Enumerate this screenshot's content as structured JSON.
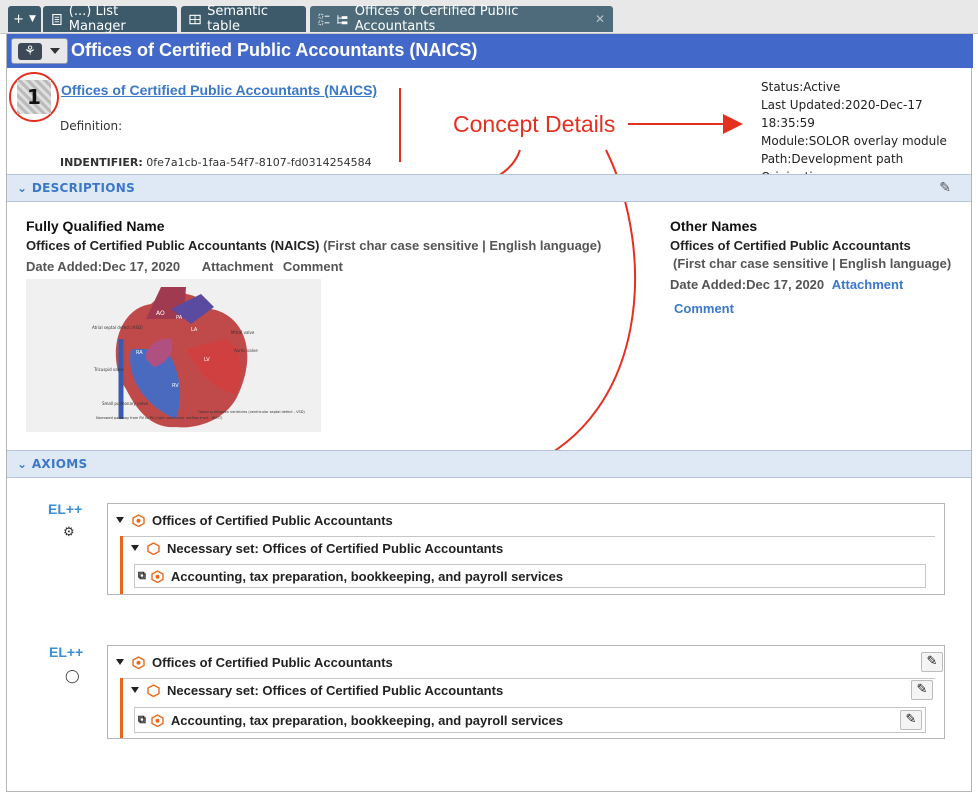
{
  "tabs": {
    "plus": "+",
    "list_manager": "(...) List Manager",
    "semantic_table": "Semantic table",
    "offices": "Offices of Certified Public Accountants"
  },
  "window": {
    "title": "Offices of Certified Public Accountants  (NAICS)"
  },
  "concept": {
    "badge": "1",
    "name": "Offices of Certified Public Accountants  (NAICS)",
    "definition_label": "Definition:",
    "identifier_label": "INDENTIFIER:",
    "identifier_value": "0fe7a1cb-1faa-54f7-8107-fd0314254584"
  },
  "meta": {
    "status_label": "Status:",
    "status_value": "Active",
    "updated_label": "Last Updated:",
    "updated_value": "2020-Dec-17 18:35:59",
    "module_label": "Module:",
    "module_value": "SOLOR overlay module",
    "path_label": "Path:",
    "path_value": "Development path",
    "origination_label": "Origination:"
  },
  "annotation": {
    "title": "Concept Details"
  },
  "descriptions": {
    "section_label": "DESCRIPTIONS",
    "fqn_header": "Fully Qualified Name",
    "fqn_name": "Offices of Certified Public Accountants  (NAICS)",
    "fqn_qualifier": "(First char case sensitive | English language)",
    "fqn_date_label": "Date Added:",
    "fqn_date_value": "Dec 17, 2020",
    "fqn_attachment": "Attachment",
    "fqn_comment": "Comment",
    "other_header": "Other Names",
    "other_name": "Offices of Certified Public Accountants",
    "other_qualifier": "(First char case sensitive | English language)",
    "other_date_label": "Date Added:",
    "other_date_value": "Dec 17, 2020",
    "other_attachment": "Attachment",
    "other_comment": "Comment",
    "heart_labels": {
      "ao": "AO",
      "pa": "PA",
      "la": "LA",
      "ra": "RA",
      "lv": "LV",
      "rv": "RV",
      "asd": "Atrial septal defect (ASD)",
      "mitral": "Mitral valve",
      "aortic": "Aortic valve",
      "tricuspid": "Tricuspid valve",
      "small_pulm": "Small pulmonary valve",
      "narrowed": "Narrowed pathway from RV to PA (right ventricular outflow tract - RVOT)",
      "vsd": "Opening between ventricles (ventricular septal defect - VSD)"
    }
  },
  "axioms": {
    "section_label": "AXIOMS",
    "el_label_1": "EL++",
    "el_label_2": "EL++",
    "box1": {
      "root": "Offices of Certified Public Accountants",
      "necessary": "Necessary set: Offices of Certified Public Accountants",
      "leaf": "Accounting, tax preparation, bookkeeping, and payroll services"
    },
    "box2": {
      "root": "Offices of Certified Public Accountants",
      "necessary": "Necessary set: Offices of Certified Public Accountants",
      "leaf": "Accounting, tax preparation, bookkeeping, and payroll services"
    }
  },
  "colors": {
    "accent_blue": "#4269c9",
    "link_blue": "#3a78c9",
    "annotation_red": "#e53020",
    "axiom_orange": "#e8681b"
  }
}
